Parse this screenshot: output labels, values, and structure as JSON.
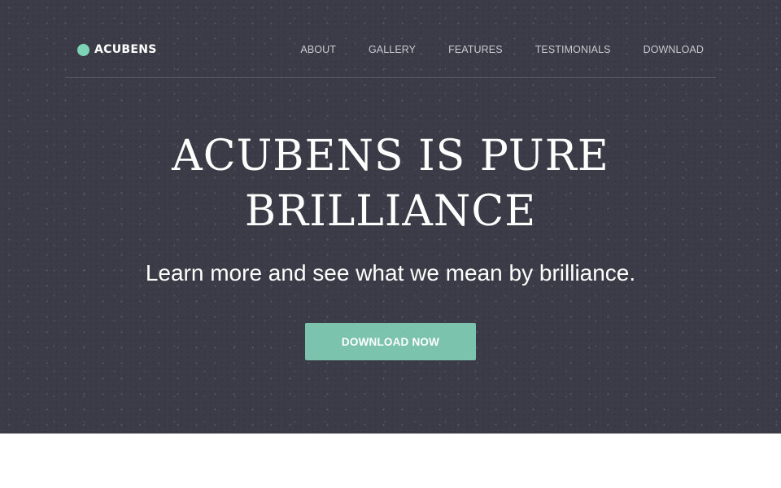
{
  "brand": {
    "name": "ACUBENS",
    "accent_color": "#7cd4b4"
  },
  "nav": {
    "items": [
      {
        "label": "ABOUT"
      },
      {
        "label": "GALLERY"
      },
      {
        "label": "FEATURES"
      },
      {
        "label": "TESTIMONIALS"
      },
      {
        "label": "DOWNLOAD"
      }
    ]
  },
  "hero": {
    "headline_line1": "ACUBENS IS PURE",
    "headline_line2": "BRILLIANCE",
    "subtitle": "Learn more and see what we mean by brilliance.",
    "cta_label": "DOWNLOAD NOW",
    "background_color": "#3c3c48",
    "button_color": "#7cc3ad"
  }
}
